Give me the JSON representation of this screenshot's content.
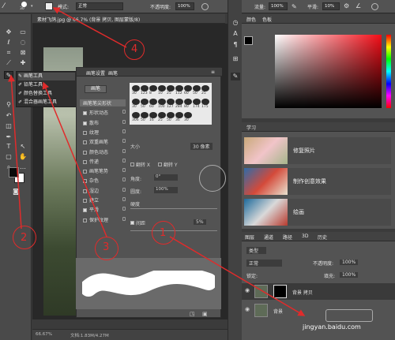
{
  "optbar": {
    "brush_size": "30",
    "mode_label": "模式:",
    "mode_value": "正常",
    "opacity_label": "不透明度:",
    "opacity_value": "100%",
    "flow_label": "流量:",
    "flow_value": "100%",
    "smooth_label": "平滑:",
    "smooth_value": "10%"
  },
  "doc": {
    "tab_title": "素材飞鸽.jpg @ 66.7% (背景 拷贝, 图层蒙版/8)",
    "zoom": "66.67%",
    "file_info": "文档:1.83M/4.27M"
  },
  "flyout": {
    "items": [
      "画笔工具",
      "铅笔工具",
      "颜色替换工具",
      "混合器画笔工具"
    ]
  },
  "brush_panel": {
    "tab1": "画笔设置",
    "tab2": "画笔",
    "brushes_button": "画笔",
    "options": [
      "画笔笔尖形状",
      "形状动态",
      "散布",
      "纹理",
      "双重画笔",
      "颜色动态",
      "传递",
      "画笔笔势",
      "杂色",
      "湿边",
      "建立",
      "平滑",
      "保护纹理"
    ],
    "options_checked": [
      false,
      true,
      true,
      false,
      false,
      false,
      false,
      false,
      false,
      false,
      false,
      true,
      false
    ],
    "tip_sizes": [
      "30",
      "123",
      "8",
      "10",
      "25",
      "112",
      "60",
      "50",
      "25",
      "30",
      "50",
      "60",
      "100",
      "127",
      "284",
      "80",
      "174",
      "175",
      "306",
      "50",
      "16",
      "25",
      "50",
      "36",
      "30"
    ],
    "size_label": "大小",
    "size_value": "30 像素",
    "flipx": "翻转 X",
    "flipy": "翻转 Y",
    "angle_label": "角度:",
    "angle_value": "0°",
    "round_label": "圆度:",
    "round_value": "100%",
    "hardness_label": "硬度",
    "spacing_label": "间距",
    "spacing_value": "5%"
  },
  "color_panel": {
    "tab1": "颜色",
    "tab2": "色板"
  },
  "learn_panel": {
    "title": "学习",
    "cards": [
      "修复照片",
      "制作创意效果",
      "绘画"
    ]
  },
  "layers_panel": {
    "tabs": [
      "图层",
      "通道",
      "路径",
      "3D",
      "历史"
    ],
    "kind": "类型",
    "blend": "正常",
    "opacity_label": "不透明度:",
    "opacity_value": "100%",
    "lock_label": "锁定:",
    "fill_label": "填充:",
    "fill_value": "100%",
    "layers": [
      "背景 拷贝",
      "背景"
    ]
  },
  "annotations": {
    "labels": [
      "1",
      "2",
      "3",
      "4"
    ]
  },
  "watermark": "jingyan.baidu.com",
  "colors": {
    "annotation": "#e02b2b"
  }
}
